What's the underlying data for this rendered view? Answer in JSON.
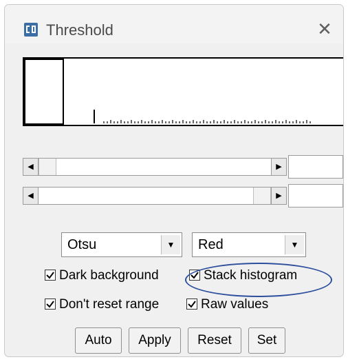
{
  "window": {
    "title": "Threshold",
    "close_glyph": "✕",
    "icon": "imagej-icon"
  },
  "histogram": {
    "description_colors": {
      "fill": "#ffffff",
      "border": "#000000",
      "bars": "#000000"
    }
  },
  "sliders": [
    {
      "name": "min-threshold",
      "value_text": ""
    },
    {
      "name": "max-threshold",
      "value_text": ""
    }
  ],
  "arrows": {
    "left": "◀",
    "right": "▶",
    "down": "▼"
  },
  "method_select": {
    "value": "Otsu"
  },
  "display_select": {
    "value": "Red"
  },
  "checkboxes": {
    "dark_background": {
      "label": "Dark background",
      "checked": true
    },
    "stack_histogram": {
      "label": "Stack histogram",
      "checked": true
    },
    "dont_reset_range": {
      "label": "Don't reset range",
      "checked": true
    },
    "raw_values": {
      "label": "Raw values",
      "checked": true
    }
  },
  "buttons": {
    "auto": "Auto",
    "apply": "Apply",
    "reset": "Reset",
    "set": "Set"
  },
  "colors": {
    "annotation_oval": "#2d4f9e",
    "window_bg": "#f0f0f0",
    "icon_blue": "#3a6ea5"
  }
}
